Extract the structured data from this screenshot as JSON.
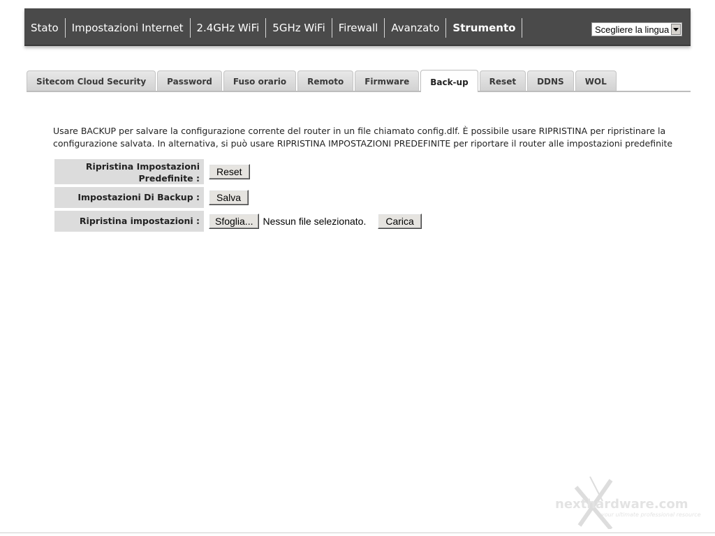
{
  "topnav": {
    "items": [
      {
        "label": "Stato"
      },
      {
        "label": "Impostazioni Internet"
      },
      {
        "label": "2.4GHz WiFi"
      },
      {
        "label": "5GHz WiFi"
      },
      {
        "label": "Firewall"
      },
      {
        "label": "Avanzato"
      },
      {
        "label": "Strumento",
        "active": true
      }
    ],
    "language_select": {
      "value": "Scegliere la lingua"
    }
  },
  "tabs": [
    {
      "label": "Sitecom Cloud Security"
    },
    {
      "label": "Password"
    },
    {
      "label": "Fuso orario"
    },
    {
      "label": "Remoto"
    },
    {
      "label": "Firmware"
    },
    {
      "label": "Back-up",
      "active": true
    },
    {
      "label": "Reset"
    },
    {
      "label": "DDNS"
    },
    {
      "label": "WOL"
    }
  ],
  "description": "Usare BACKUP per salvare la configurazione corrente del router in un file chiamato config.dlf. È possibile usare RIPRISTINA per ripristinare la configurazione salvata. In alternativa, si può usare RIPRISTINA IMPOSTAZIONI PREDEFINITE per riportare il router alle impostazioni predefinite",
  "settings": {
    "reset_row": {
      "label": "Ripristina Impostazioni Predefinite :",
      "button": "Reset"
    },
    "backup_row": {
      "label": "Impostazioni Di Backup :",
      "button": "Salva"
    },
    "restore_row": {
      "label": "Ripristina impostazioni :",
      "browse_button": "Sfoglia...",
      "file_status": "Nessun file selezionato.",
      "upload_button": "Carica"
    }
  },
  "watermark": {
    "text": "nexthardware.com",
    "tagline": "your ultimate professional resource"
  },
  "icons": {
    "dropdown": "chevron-down-icon",
    "watermark_logo": "x-logo-icon"
  }
}
